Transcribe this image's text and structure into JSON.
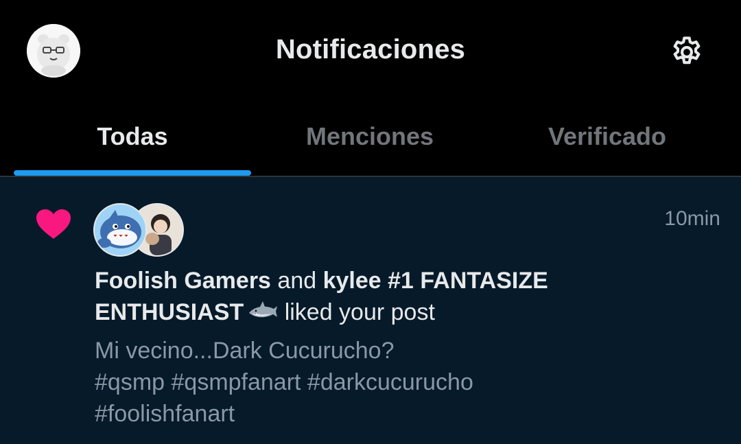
{
  "header": {
    "title": "Notificaciones",
    "avatar_icon": "bear-avatar-icon",
    "settings_icon": "gear-icon"
  },
  "tabs": [
    {
      "label": "Todas",
      "active": true
    },
    {
      "label": "Menciones",
      "active": false
    },
    {
      "label": "Verificado",
      "active": false
    }
  ],
  "notification": {
    "icon": "heart-icon",
    "time": "10min",
    "user1": "Foolish Gamers",
    "connector": "and",
    "user2_line1": "kylee #1 FANTASIZE",
    "user2_line2": "ENTHUSIAST",
    "user2_emoji": "shark-emoji-icon",
    "action": "liked your post",
    "excerpt_line1": "Mi vecino...Dark Cucurucho?",
    "excerpt_line2": "#qsmp #qsmpfanart #darkcucurucho",
    "excerpt_line3": "#foolishfanart"
  },
  "colors": {
    "background": "#000000",
    "notification_bg": "#061a2a",
    "accent": "#1d9bf0",
    "heart": "#f91880",
    "muted_text": "#8b98a5"
  }
}
